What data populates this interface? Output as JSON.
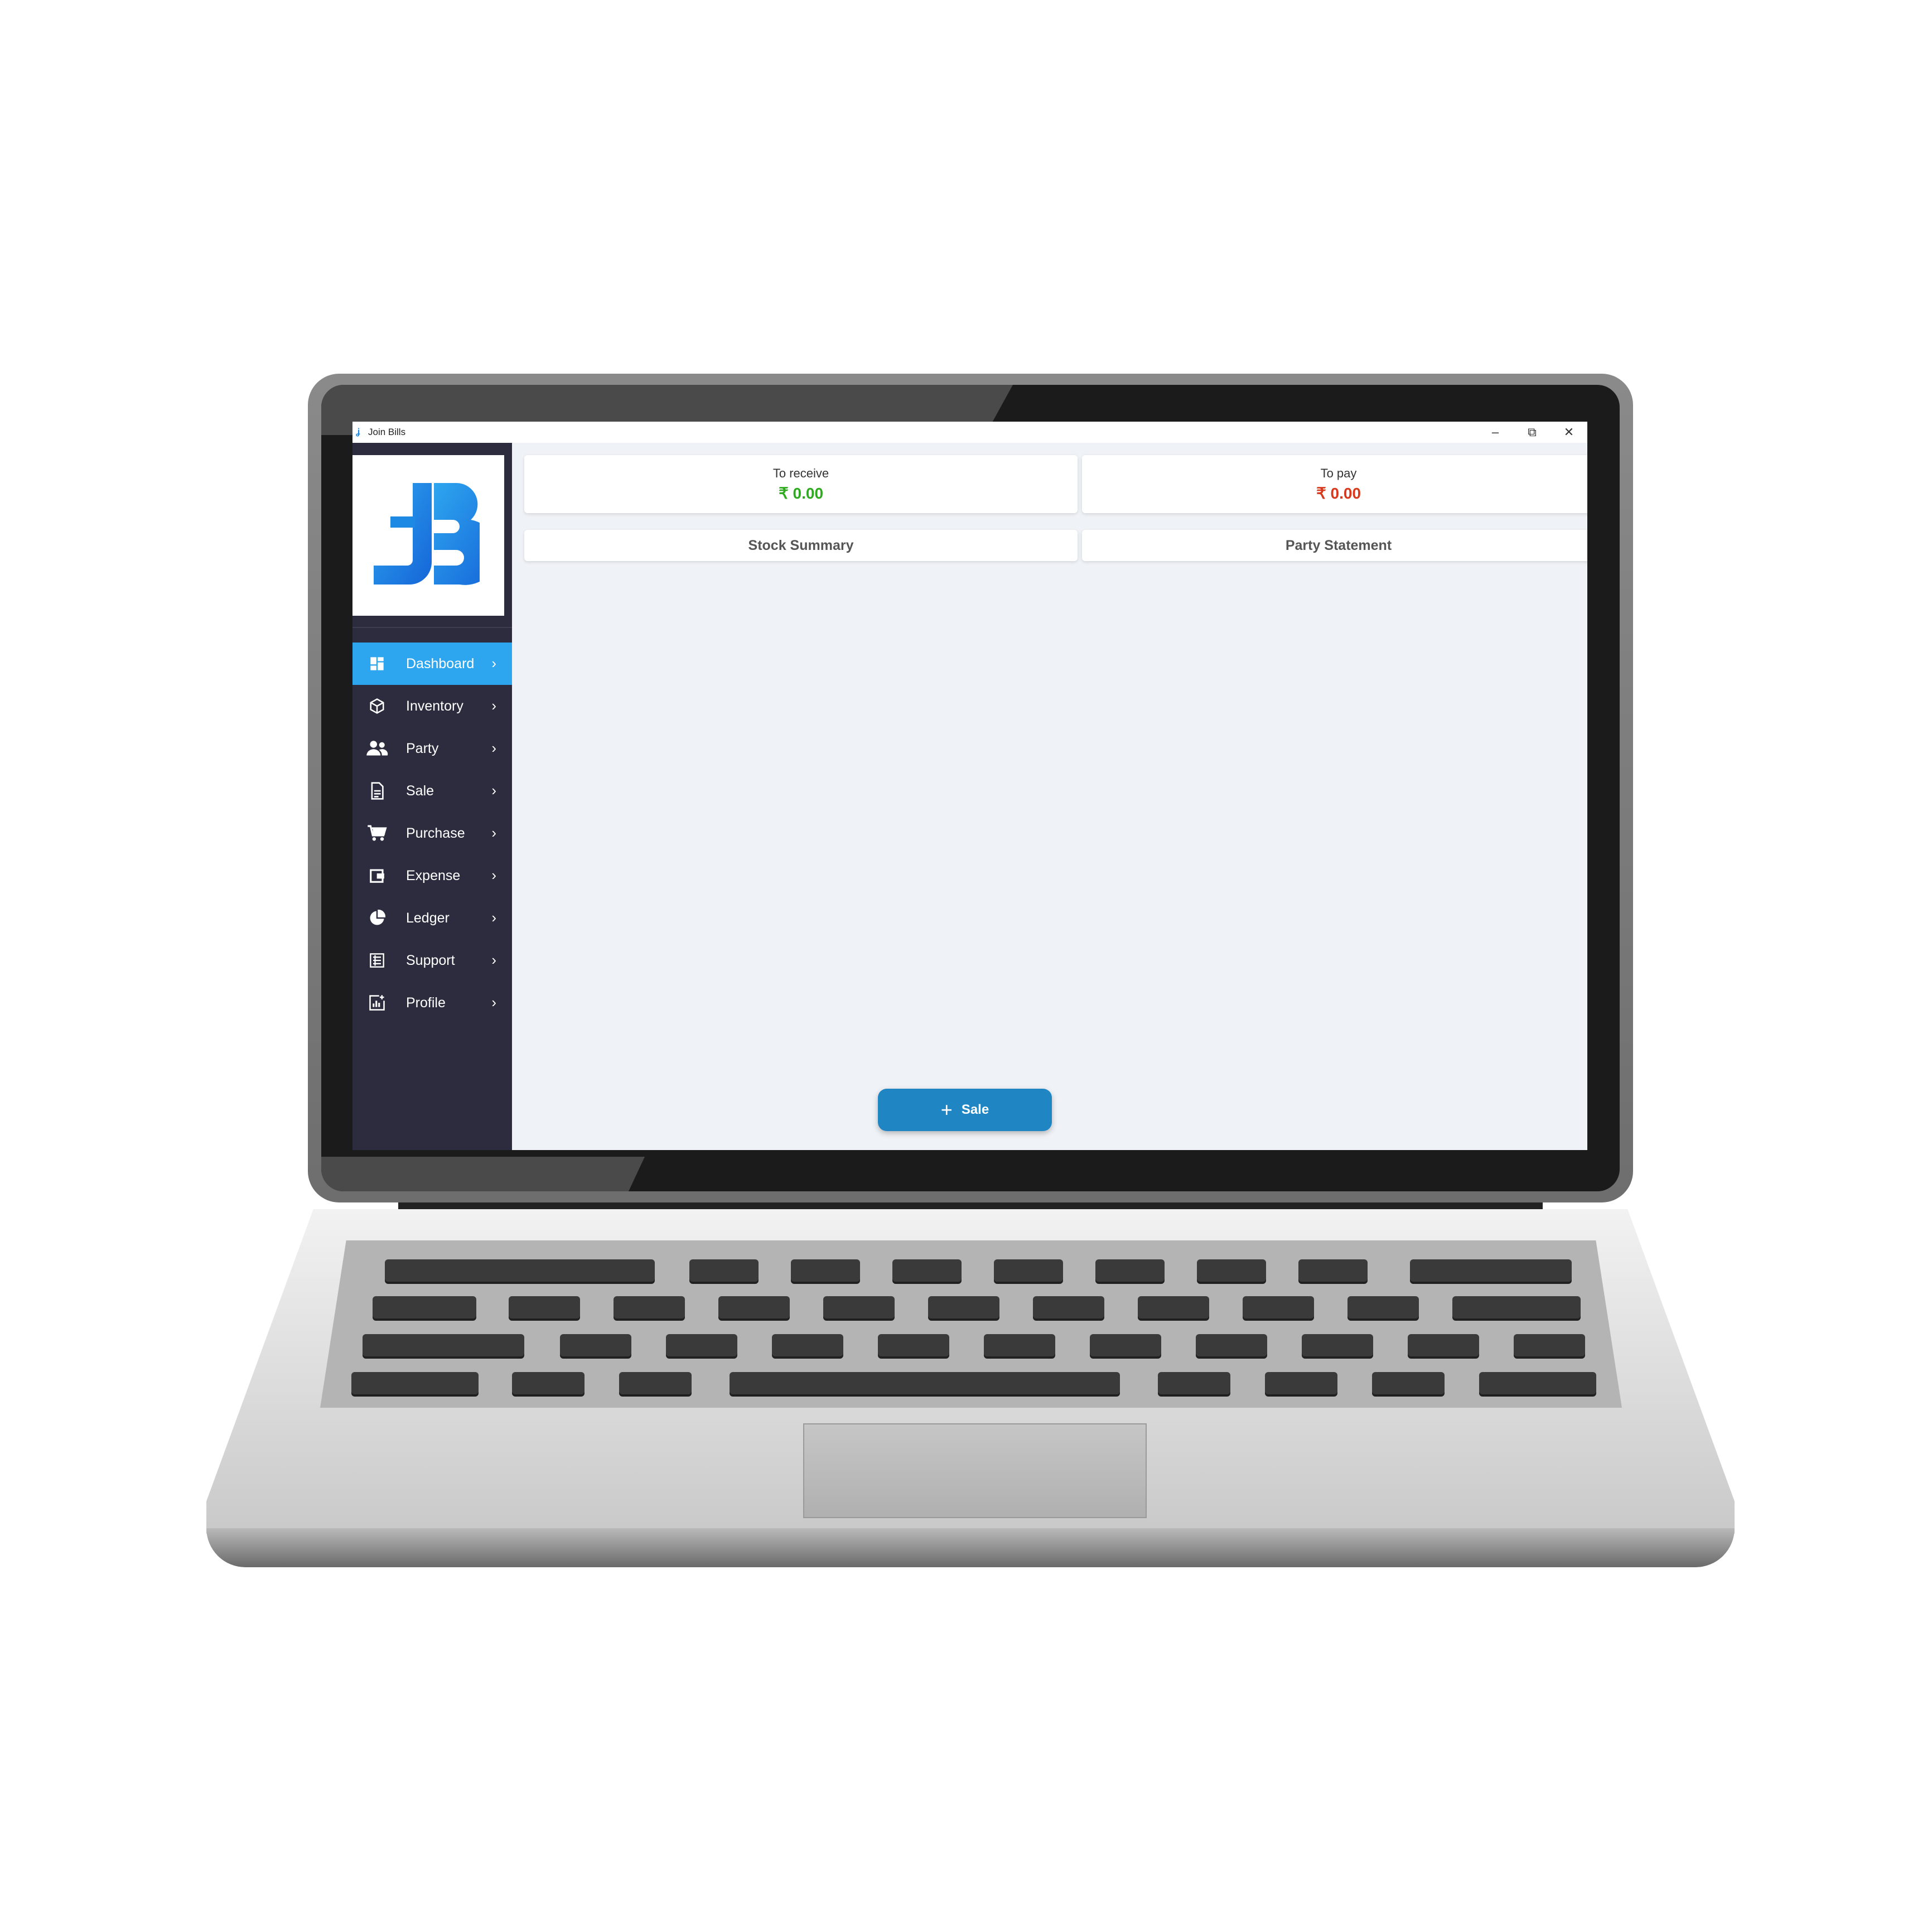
{
  "window": {
    "title": "Join Bills",
    "controls": {
      "minimize": "–",
      "maximize": "⧉",
      "close": "✕"
    }
  },
  "brand": {
    "logo_text": "JB",
    "colors": {
      "primary": "#1e88e5",
      "secondary": "#2ea6ef"
    }
  },
  "sidebar": {
    "items": [
      {
        "label": "Dashboard",
        "icon": "dashboard-icon",
        "active": true
      },
      {
        "label": "Inventory",
        "icon": "box-icon",
        "active": false
      },
      {
        "label": "Party",
        "icon": "users-icon",
        "active": false
      },
      {
        "label": "Sale",
        "icon": "document-icon",
        "active": false
      },
      {
        "label": "Purchase",
        "icon": "cart-icon",
        "active": false
      },
      {
        "label": "Expense",
        "icon": "wallet-icon",
        "active": false
      },
      {
        "label": "Ledger",
        "icon": "pie-chart-icon",
        "active": false
      },
      {
        "label": "Support",
        "icon": "list-icon",
        "active": false
      },
      {
        "label": "Profile",
        "icon": "report-icon",
        "active": false
      }
    ],
    "chevron": "›"
  },
  "summary": {
    "receive": {
      "label": "To receive",
      "value": "₹ 0.00",
      "color": "#2eaa1f"
    },
    "pay": {
      "label": "To pay",
      "value": "₹ 0.00",
      "color": "#d8381b"
    }
  },
  "actions": {
    "stock_summary": "Stock Summary",
    "party_statement": "Party Statement"
  },
  "fab": {
    "plus": "+",
    "label": "Sale"
  }
}
